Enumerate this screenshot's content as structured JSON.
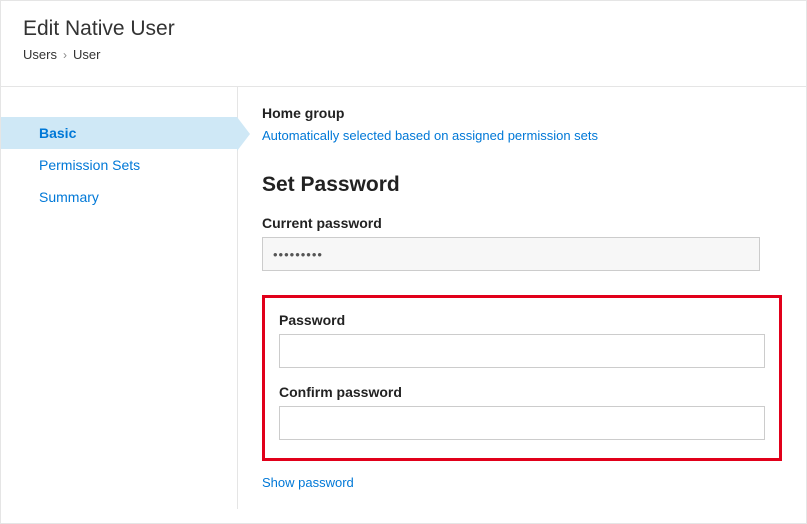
{
  "header": {
    "title": "Edit Native User",
    "breadcrumb": {
      "root": "Users",
      "current": "User"
    }
  },
  "sidebar": {
    "items": [
      {
        "label": "Basic",
        "active": true
      },
      {
        "label": "Permission Sets",
        "active": false
      },
      {
        "label": "Summary",
        "active": false
      }
    ]
  },
  "content": {
    "home_group_label": "Home group",
    "home_group_hint": "Automatically selected based on assigned permission sets",
    "set_password_title": "Set Password",
    "current_password_label": "Current password",
    "current_password_value": "•••••••••",
    "password_label": "Password",
    "password_value": "",
    "confirm_password_label": "Confirm password",
    "confirm_password_value": "",
    "show_password_label": "Show password"
  }
}
